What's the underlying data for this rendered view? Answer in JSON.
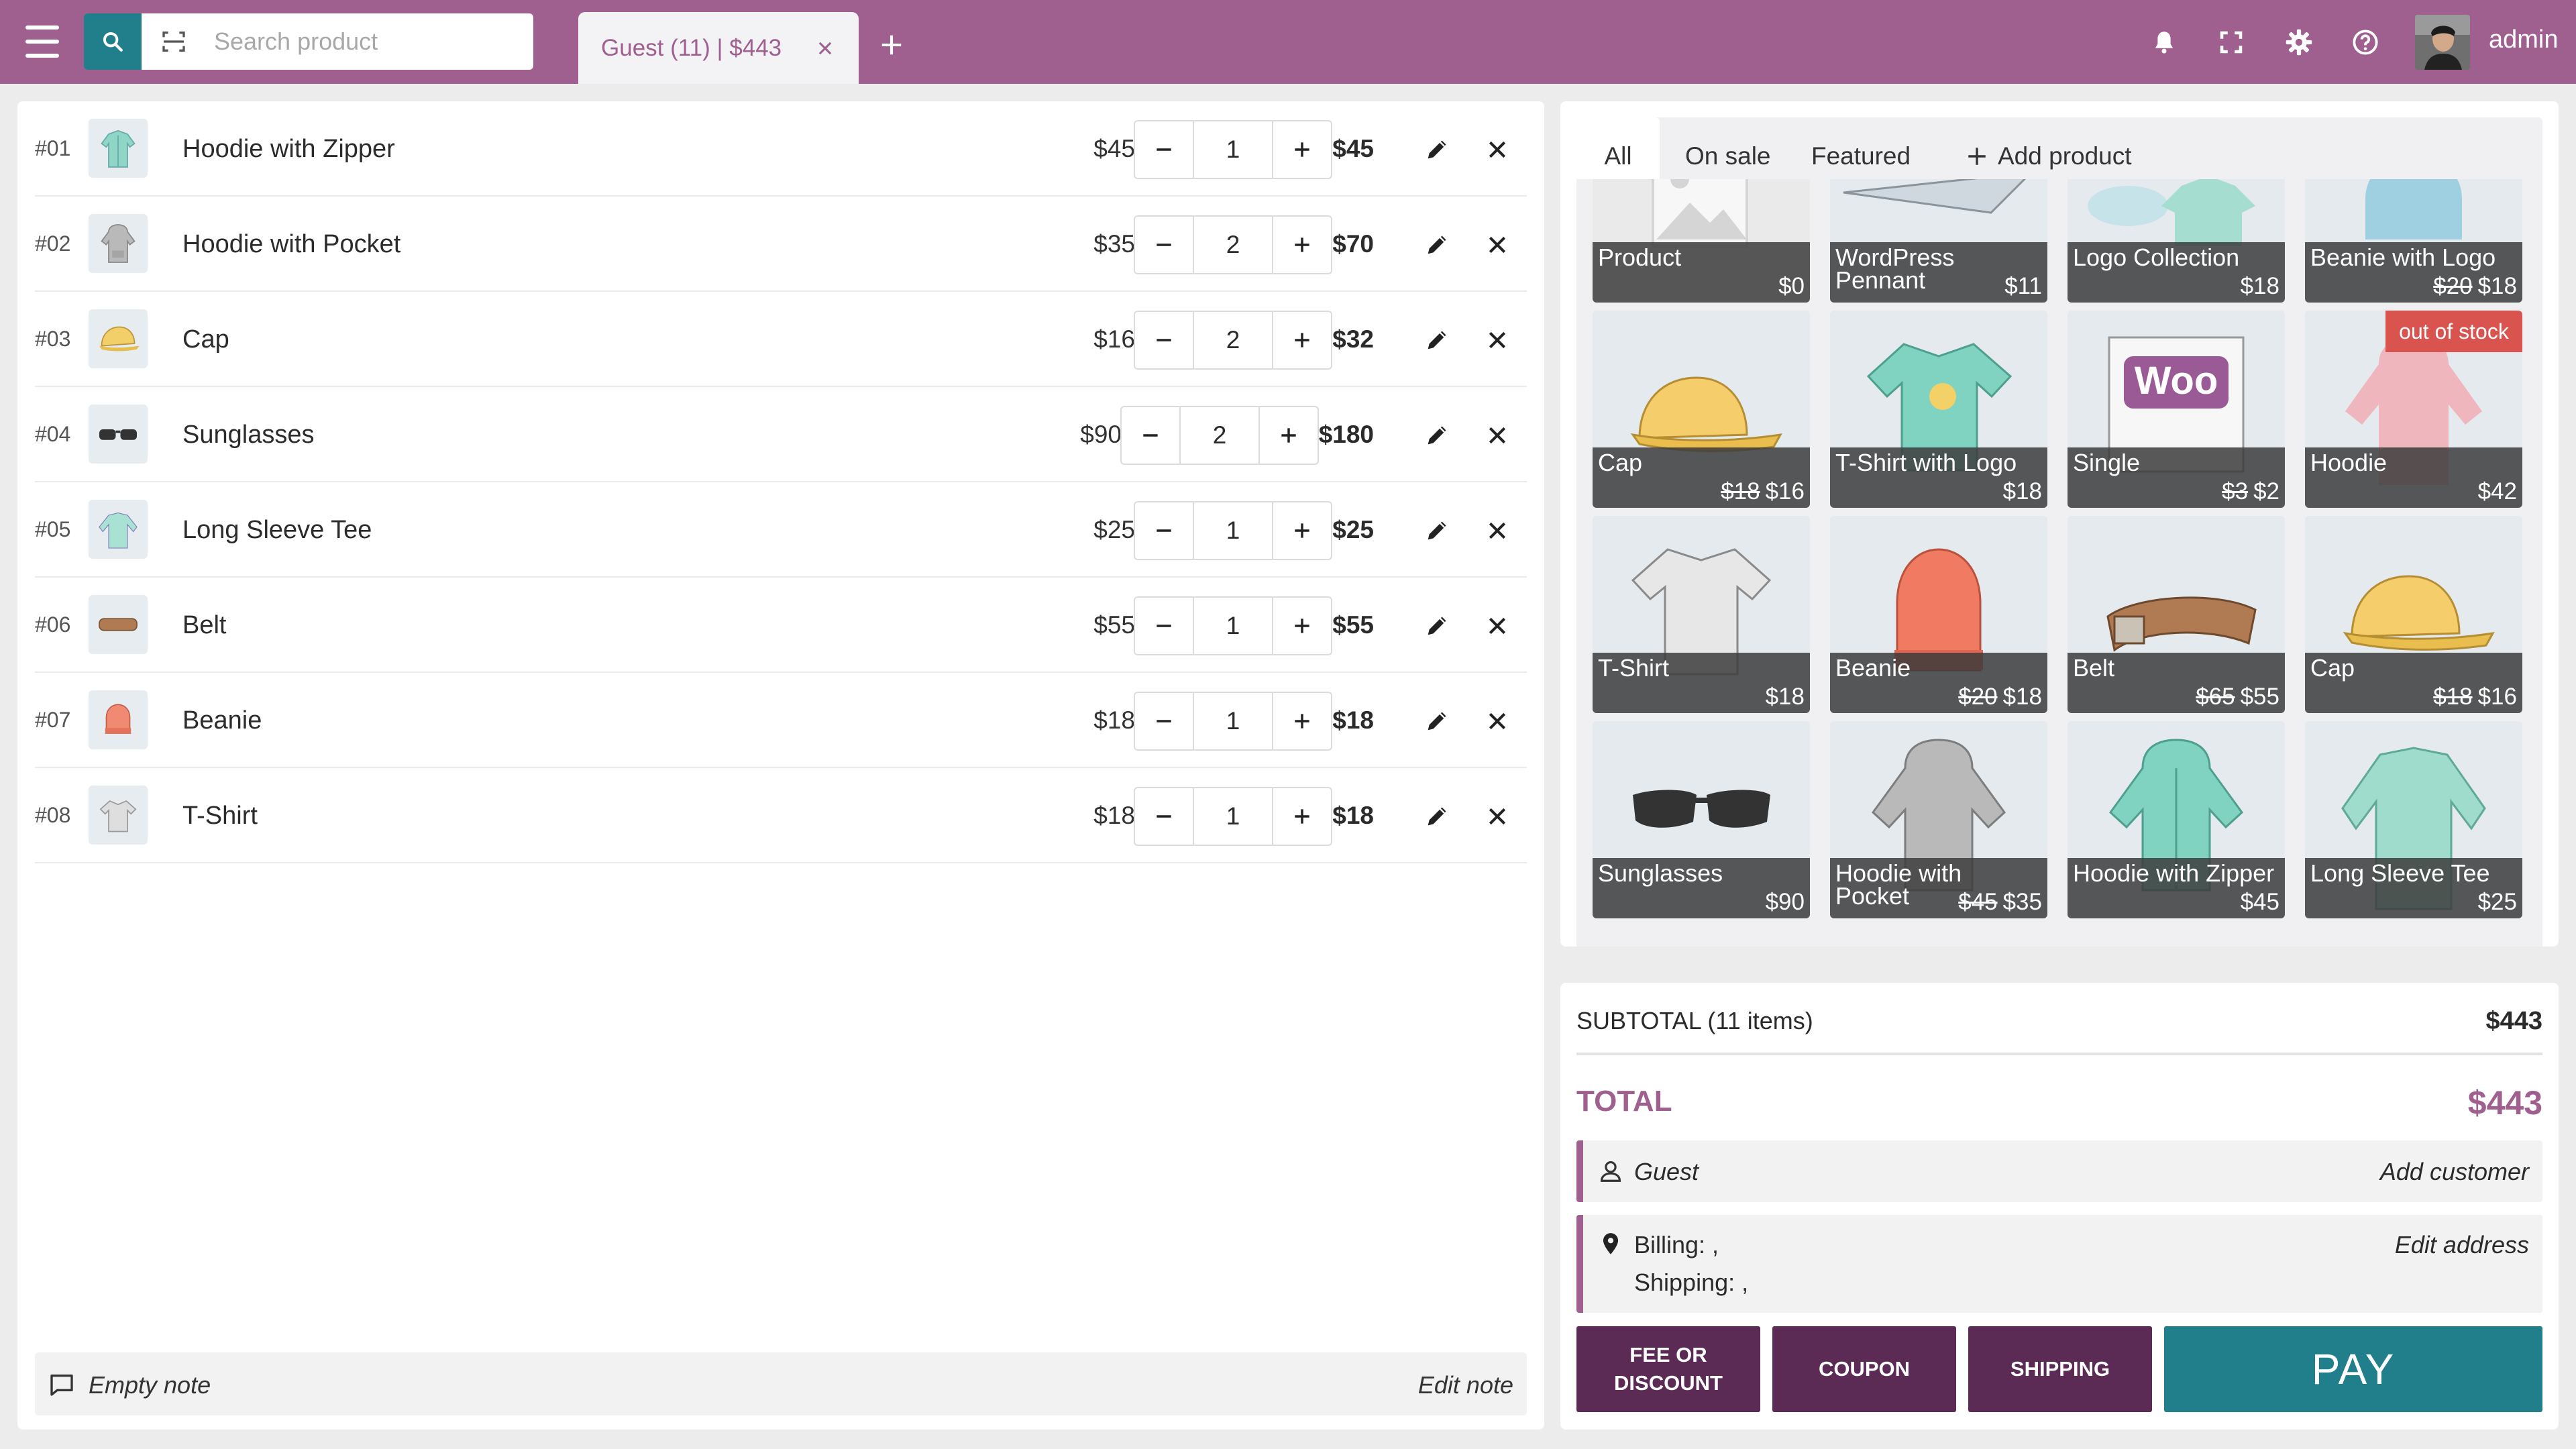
{
  "header": {
    "search_placeholder": "Search product",
    "tab_label": "Guest (11) | $443",
    "user_name": "admin"
  },
  "cart": {
    "items": [
      {
        "num": "#01",
        "name": "Hoodie with Zipper",
        "price": "$45",
        "qty": "1",
        "total": "$45"
      },
      {
        "num": "#02",
        "name": "Hoodie with Pocket",
        "price": "$35",
        "qty": "2",
        "total": "$70"
      },
      {
        "num": "#03",
        "name": "Cap",
        "price": "$16",
        "qty": "2",
        "total": "$32"
      },
      {
        "num": "#04",
        "name": "Sunglasses",
        "price": "$90",
        "qty": "2",
        "total": "$180"
      },
      {
        "num": "#05",
        "name": "Long Sleeve Tee",
        "price": "$25",
        "qty": "1",
        "total": "$25"
      },
      {
        "num": "#06",
        "name": "Belt",
        "price": "$55",
        "qty": "1",
        "total": "$55"
      },
      {
        "num": "#07",
        "name": "Beanie",
        "price": "$18",
        "qty": "1",
        "total": "$18"
      },
      {
        "num": "#08",
        "name": "T-Shirt",
        "price": "$18",
        "qty": "1",
        "total": "$18"
      }
    ],
    "note_text": "Empty note",
    "note_action": "Edit note"
  },
  "products": {
    "tabs": [
      "All",
      "On sale",
      "Featured",
      "Add product"
    ],
    "tiles": [
      {
        "name": "Product",
        "old": "",
        "price": "$0"
      },
      {
        "name": "WordPress Pennant",
        "old": "",
        "price": "$11"
      },
      {
        "name": "Logo Collection",
        "old": "",
        "price": "$18"
      },
      {
        "name": "Beanie with Logo",
        "old": "$20",
        "price": "$18"
      },
      {
        "name": "Cap",
        "old": "$18",
        "price": "$16"
      },
      {
        "name": "T-Shirt with Logo",
        "old": "",
        "price": "$18"
      },
      {
        "name": "Single",
        "old": "$3",
        "price": "$2"
      },
      {
        "name": "Hoodie",
        "old": "",
        "price": "$42",
        "badge": "out of stock"
      },
      {
        "name": "T-Shirt",
        "old": "",
        "price": "$18"
      },
      {
        "name": "Beanie",
        "old": "$20",
        "price": "$18"
      },
      {
        "name": "Belt",
        "old": "$65",
        "price": "$55"
      },
      {
        "name": "Cap",
        "old": "$18",
        "price": "$16"
      },
      {
        "name": "Sunglasses",
        "old": "",
        "price": "$90"
      },
      {
        "name": "Hoodie with Pocket",
        "old": "$45",
        "price": "$35"
      },
      {
        "name": "Hoodie with Zipper",
        "old": "",
        "price": "$45"
      },
      {
        "name": "Long Sleeve Tee",
        "old": "",
        "price": "$25"
      }
    ]
  },
  "totals": {
    "subtotal_label": "SUBTOTAL (11 items)",
    "subtotal_value": "$443",
    "total_label": "TOTAL",
    "total_value": "$443",
    "customer": "Guest",
    "customer_action": "Add customer",
    "billing": "Billing: ,",
    "shipping": "Shipping: ,",
    "address_action": "Edit address",
    "fee_line1": "FEE OR",
    "fee_line2": "DISCOUNT",
    "coupon": "COUPON",
    "shipping_btn": "SHIPPING",
    "pay": "PAY"
  },
  "colors": {
    "brand": "#a0608f",
    "teal": "#217f8c",
    "dark_purple": "#5b2a55",
    "badge_red": "#d9534f"
  }
}
